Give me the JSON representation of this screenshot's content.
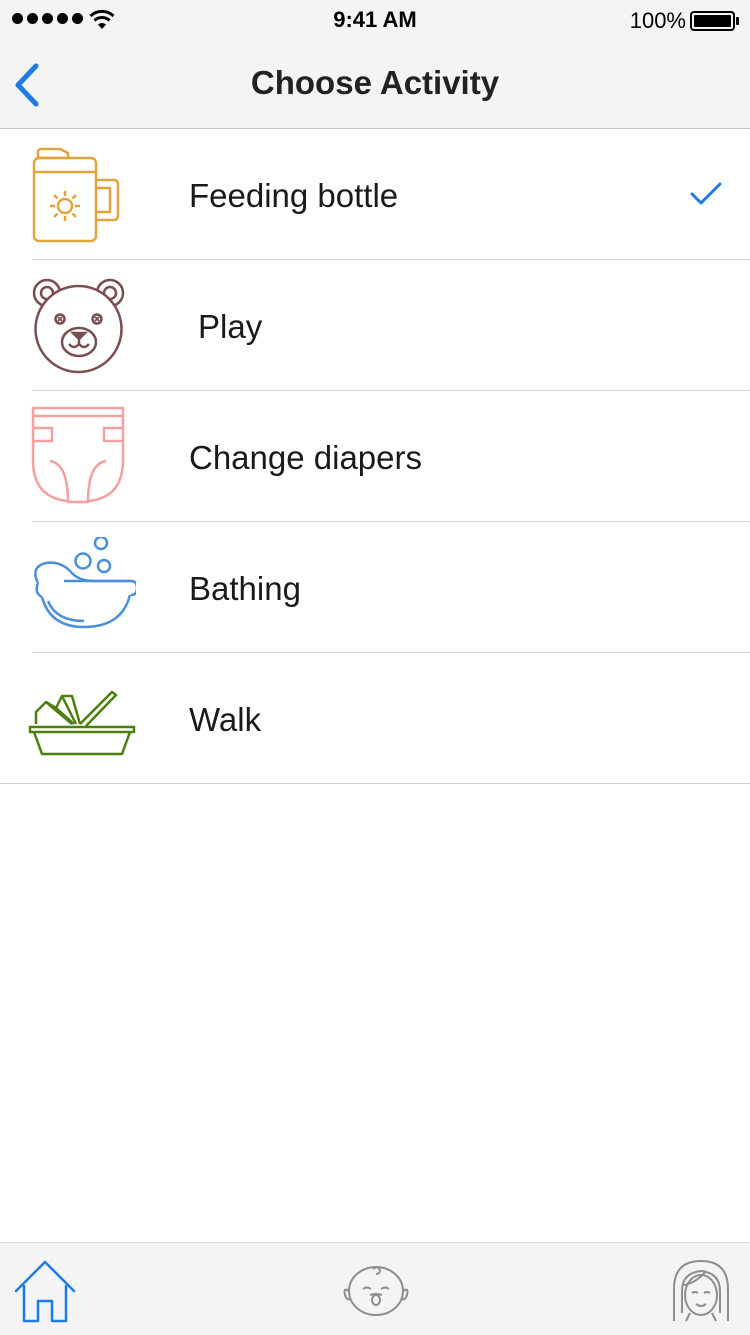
{
  "status_bar": {
    "time": "9:41 AM",
    "battery_percent": "100%",
    "signal_icon": "cellular-signal-icon",
    "wifi_icon": "wifi-icon",
    "battery_icon": "battery-icon"
  },
  "nav_bar": {
    "title": "Choose Activity",
    "back_icon": "chevron-left-icon"
  },
  "colors": {
    "accent": "#1e7be6",
    "bottle": "#e2a33c",
    "bear": "#7a4e4e",
    "diaper": "#f2a0a0",
    "bath": "#4b8fdc",
    "walk": "#4d7f0f",
    "tab_inactive": "#8e8e8e"
  },
  "activities": [
    {
      "label": "Feeding bottle",
      "icon": "feeding-bottle-icon",
      "selected": true
    },
    {
      "label": "Play",
      "icon": "teddy-bear-icon",
      "selected": false
    },
    {
      "label": "Change diapers",
      "icon": "diaper-icon",
      "selected": false
    },
    {
      "label": "Bathing",
      "icon": "bathtub-icon",
      "selected": false
    },
    {
      "label": "Walk",
      "icon": "bassinet-icon",
      "selected": false
    }
  ],
  "selected_icon": "checkmark-icon",
  "tab_bar": {
    "tabs": [
      {
        "icon": "home-icon",
        "active": true
      },
      {
        "icon": "baby-face-icon",
        "active": false
      },
      {
        "icon": "mother-face-icon",
        "active": false
      }
    ]
  }
}
